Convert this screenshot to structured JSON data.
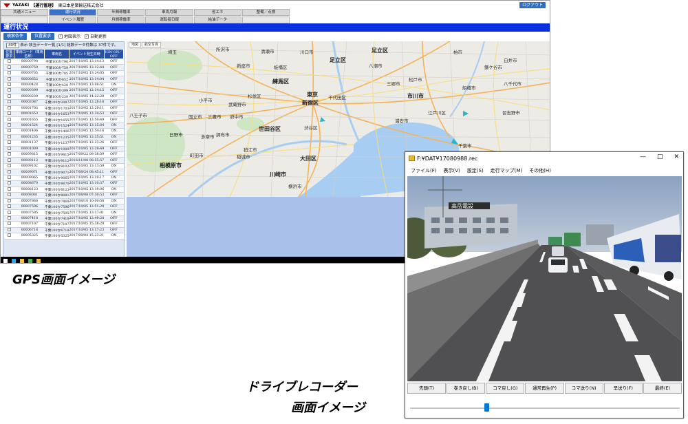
{
  "gps": {
    "header": {
      "brand": "YAZAKI",
      "system": "【運行管理】",
      "company": "東日本産業輸送株式会社",
      "logout_label": "ログアウト"
    },
    "nav_row1": [
      "共通メニュー",
      "運行状況",
      "年間稼働率",
      "車両月報",
      "省エネ",
      "整備／点検"
    ],
    "nav_row2": [
      "",
      "イベント履歴",
      "月間稼働率",
      "運転者日報",
      "給油データ",
      ""
    ],
    "active_nav": "運行状況",
    "page_title": "運行状況",
    "toolbar": {
      "search_label": "検索条件",
      "position_label": "位置要求",
      "map_display_label": "地図表示",
      "auto_update_label": "自動更新"
    },
    "panel": {
      "per_page": "40件",
      "show_label": "表示",
      "info_text": "該当データ一覧 [1/1] 総数データ件数は 37件です。"
    },
    "table": {
      "headers": [
        "位置要求",
        "車両コード（車両名称）",
        "車両名",
        "イベント発生日時",
        "IGN-ON／OFF"
      ],
      "rows": [
        [
          "00000790",
          "千葉100か790",
          "2017/10/05 13:14:13",
          "OFF"
        ],
        [
          "00000759",
          "千葉100か759",
          "2017/10/05 13:12:44",
          "OFF"
        ],
        [
          "00000705",
          "千葉100か705",
          "2017/10/05 13:24:05",
          "OFF"
        ],
        [
          "00000652",
          "千葉100か652",
          "2017/10/05 13:14:04",
          "OFF"
        ],
        [
          "00000428",
          "千葉100か428",
          "2017/10/05 13:08:51",
          "ON"
        ],
        [
          "00000399",
          "千葉100か399",
          "2017/10/05 12:14:15",
          "OFF"
        ],
        [
          "00000239",
          "千葉100か239",
          "2017/10/05 14:22:20",
          "OFF"
        ],
        [
          "00002087",
          "千葉100か2087",
          "2017/10/05 12:28:18",
          "OFF"
        ],
        [
          "00001703",
          "千葉100か1703",
          "2017/10/05 12:29:11",
          "OFF"
        ],
        [
          "00001653",
          "千葉100か1653",
          "2017/10/05 12:34:53",
          "OFF"
        ],
        [
          "00001655",
          "千葉100か1655",
          "2017/10/05 12:50:49",
          "OFF"
        ],
        [
          "00001524",
          "千葉100か1524",
          "2017/10/05 13:15:04",
          "ON"
        ],
        [
          "00001406",
          "千葉100か1406",
          "2017/10/05 12:54:16",
          "ON"
        ],
        [
          "00001235",
          "千葉100か1235",
          "2017/10/05 12:35:51",
          "ON"
        ],
        [
          "00001137",
          "千葉100か1137",
          "2017/10/05 12:23:26",
          "OFF"
        ],
        [
          "00001009",
          "千葉100か1009",
          "2017/10/05 12:29:49",
          "OFF"
        ],
        [
          "00009815",
          "千葉100か9815",
          "2017/09/22 09:38:39",
          "OFF"
        ],
        [
          "00009112",
          "千葉100か9112",
          "2016/11/08 08:55:57",
          "OFF"
        ],
        [
          "00009102",
          "千葉100か9102",
          "2017/10/05 13:13:59",
          "ON"
        ],
        [
          "00009071",
          "千葉100か9071",
          "2017/08/24 08:45:11",
          "OFF"
        ],
        [
          "00009065",
          "千葉100か9065",
          "2017/10/05 13:19:17",
          "ON"
        ],
        [
          "00008670",
          "千葉100か8670",
          "2017/10/05 13:10:37",
          "OFF"
        ],
        [
          "00008123",
          "千葉100か8123",
          "2017/10/05 13:19:06",
          "ON"
        ],
        [
          "00008081",
          "千葉100か8081",
          "2017/08/08 07:30:53",
          "OFF"
        ],
        [
          "00007868",
          "千葉100か7868",
          "2017/08/10 10:00:56",
          "ON"
        ],
        [
          "00007596",
          "千葉100か7596",
          "2017/10/05 12:51:20",
          "OFF"
        ],
        [
          "00007595",
          "千葉100か7595",
          "2017/10/05 13:17:01",
          "ON"
        ],
        [
          "00007418",
          "千葉100か7418",
          "2017/10/05 12:49:28",
          "OFF"
        ],
        [
          "00007107",
          "千葉100か7107",
          "2017/10/05 15:38:29",
          "OFF"
        ],
        [
          "00006718",
          "千葉100か6718",
          "2017/10/05 13:17:23",
          "OFF"
        ],
        [
          "00005325",
          "千葉100か5325",
          "2017/09/04 15:23:21",
          "ON"
        ]
      ]
    },
    "map": {
      "tabs": [
        "地図",
        "航空写真"
      ],
      "labels": [
        "所沢市",
        "清瀬市",
        "新座市",
        "川口市",
        "足立区",
        "練馬区",
        "東京",
        "新宿区",
        "千代田区",
        "杉並区",
        "世田谷区",
        "渋谷区",
        "江戸川区",
        "市川市",
        "船橋市",
        "三鷹市",
        "調布市",
        "府中市",
        "国立市",
        "小平市",
        "八王子市",
        "多摩市",
        "町田市",
        "相模原市",
        "川崎市",
        "大田区",
        "横浜市",
        "柏市",
        "鎌ケ谷市",
        "千葉市",
        "白井市",
        "八千代市",
        "習志野市",
        "松戸市",
        "浦安市",
        "八潮市",
        "三郷市",
        "足立区",
        "板橋区",
        "埼玉",
        "武蔵野市",
        "狛江市",
        "稲城市",
        "日野市"
      ]
    }
  },
  "captions": {
    "gps": "GPS画面イメージ",
    "rec_line1": "ドライブレコーダー",
    "rec_line2": "画面イメージ"
  },
  "recorder": {
    "title": "F:¥DAT¥17080988.rec",
    "window_controls": [
      "—",
      "□",
      "✕"
    ],
    "menu": [
      "ファイル(F)",
      "表示(V)",
      "設定(S)",
      "走行マップ(M)",
      "その他(H)"
    ],
    "controls": [
      "先頭(T)",
      "巻き戻し(B)",
      "コマ戻し(G)",
      "通常再生(P)",
      "コマ送り(N)",
      "早送り(F)",
      "最終(E)"
    ],
    "slider_position": 0.28,
    "video_sign": "高岳電設"
  }
}
